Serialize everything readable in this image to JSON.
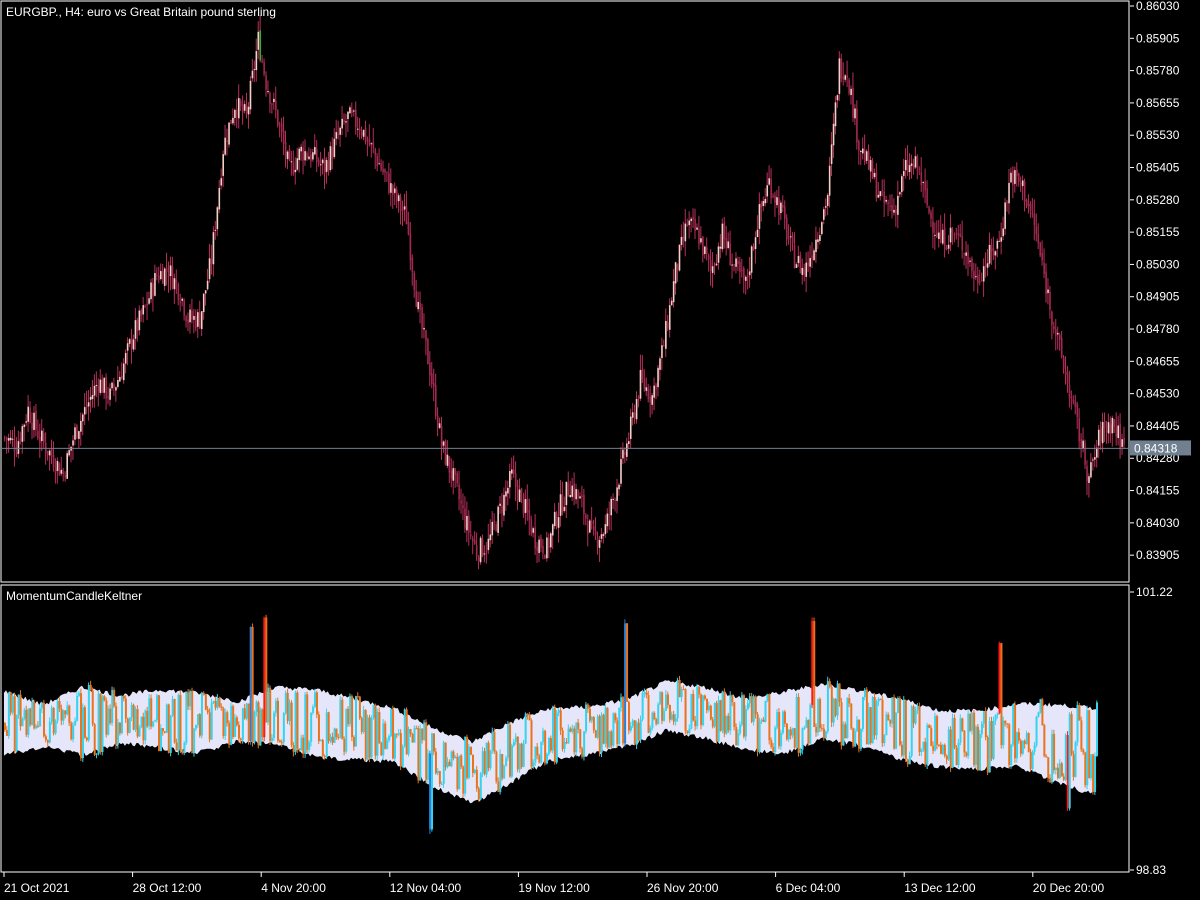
{
  "main_panel": {
    "title": "EURGBP., H4:  euro vs Great Britain pound sterling",
    "current_price": "0.84318"
  },
  "sub_panel": {
    "title": "MomentumCandleKeltner"
  },
  "colors": {
    "background": "#000000",
    "frame": "#ffffff",
    "bull_candle": "#f5cfc3",
    "bear_candle": "#a3294f",
    "wick": "#b8305a",
    "highlight_bull": "#3fa83a",
    "current_price_line": "#708090",
    "price_box": "#708090",
    "band_fill": "#e6e6fa",
    "mom_up": "#35d3ee",
    "mom_down": "#e8731d",
    "mom_strong_down": "#ff1a1a",
    "mom_strong_up": "#2a7fd8"
  },
  "chart_data": [
    {
      "type": "candlestick",
      "title": "EURGBP., H4:  euro vs Great Britain pound sterling",
      "y_ticks": [
        "0.86030",
        "0.85905",
        "0.85780",
        "0.85655",
        "0.85530",
        "0.85405",
        "0.85280",
        "0.85155",
        "0.85030",
        "0.84905",
        "0.84780",
        "0.84655",
        "0.84530",
        "0.84405",
        "0.84280",
        "0.84155",
        "0.84030",
        "0.83905"
      ],
      "ylim": [
        0.83805,
        0.8603
      ],
      "current_price": 0.84318,
      "x_ticks": [
        "21 Oct 2021",
        "28 Oct 12:00",
        "4 Nov 20:00",
        "12 Nov 04:00",
        "19 Nov 12:00",
        "26 Nov 20:00",
        "6 Dec 04:00",
        "13 Dec 12:00",
        "20 Dec 20:00"
      ],
      "close_path": [
        [
          0,
          0.8436
        ],
        [
          6,
          0.8433
        ],
        [
          12,
          0.8447
        ],
        [
          18,
          0.8436
        ],
        [
          24,
          0.8429
        ],
        [
          30,
          0.8422
        ],
        [
          36,
          0.8438
        ],
        [
          42,
          0.8448
        ],
        [
          48,
          0.8458
        ],
        [
          54,
          0.8452
        ],
        [
          60,
          0.8462
        ],
        [
          66,
          0.8476
        ],
        [
          72,
          0.8486
        ],
        [
          78,
          0.8499
        ],
        [
          84,
          0.8501
        ],
        [
          90,
          0.8492
        ],
        [
          94,
          0.8482
        ],
        [
          100,
          0.8482
        ],
        [
          106,
          0.8505
        ],
        [
          112,
          0.8548
        ],
        [
          118,
          0.8565
        ],
        [
          124,
          0.856
        ],
        [
          130,
          0.859
        ],
        [
          134,
          0.8574
        ],
        [
          140,
          0.8559
        ],
        [
          146,
          0.8539
        ],
        [
          152,
          0.8547
        ],
        [
          158,
          0.8545
        ],
        [
          164,
          0.854
        ],
        [
          170,
          0.8551
        ],
        [
          176,
          0.856
        ],
        [
          182,
          0.8557
        ],
        [
          188,
          0.8548
        ],
        [
          194,
          0.8539
        ],
        [
          200,
          0.8529
        ],
        [
          206,
          0.8521
        ],
        [
          212,
          0.8485
        ],
        [
          218,
          0.8463
        ],
        [
          224,
          0.8433
        ],
        [
          230,
          0.842
        ],
        [
          236,
          0.8404
        ],
        [
          242,
          0.8392
        ],
        [
          248,
          0.8395
        ],
        [
          254,
          0.8408
        ],
        [
          260,
          0.8421
        ],
        [
          266,
          0.841
        ],
        [
          272,
          0.8397
        ],
        [
          278,
          0.8393
        ],
        [
          284,
          0.8408
        ],
        [
          290,
          0.8418
        ],
        [
          296,
          0.841
        ],
        [
          302,
          0.8396
        ],
        [
          308,
          0.8401
        ],
        [
          314,
          0.8418
        ],
        [
          320,
          0.8436
        ],
        [
          326,
          0.8458
        ],
        [
          332,
          0.8452
        ],
        [
          338,
          0.8472
        ],
        [
          344,
          0.85
        ],
        [
          350,
          0.8519
        ],
        [
          356,
          0.8514
        ],
        [
          362,
          0.85
        ],
        [
          368,
          0.8515
        ],
        [
          374,
          0.8502
        ],
        [
          380,
          0.8495
        ],
        [
          386,
          0.852
        ],
        [
          392,
          0.8535
        ],
        [
          398,
          0.8524
        ],
        [
          404,
          0.8507
        ],
        [
          410,
          0.85
        ],
        [
          416,
          0.8513
        ],
        [
          422,
          0.853
        ],
        [
          428,
          0.858
        ],
        [
          432,
          0.8578
        ],
        [
          438,
          0.855
        ],
        [
          444,
          0.8539
        ],
        [
          450,
          0.8527
        ],
        [
          456,
          0.8524
        ],
        [
          462,
          0.854
        ],
        [
          468,
          0.8541
        ],
        [
          474,
          0.8523
        ],
        [
          480,
          0.8512
        ],
        [
          486,
          0.8515
        ],
        [
          492,
          0.851
        ],
        [
          498,
          0.8497
        ],
        [
          504,
          0.8505
        ],
        [
          510,
          0.8512
        ],
        [
          516,
          0.8538
        ],
        [
          522,
          0.8533
        ],
        [
          528,
          0.8518
        ],
        [
          534,
          0.8495
        ],
        [
          540,
          0.8473
        ],
        [
          546,
          0.8454
        ],
        [
          552,
          0.8434
        ],
        [
          556,
          0.842
        ],
        [
          562,
          0.8438
        ],
        [
          568,
          0.8442
        ],
        [
          574,
          0.8432
        ]
      ],
      "green_candles": [
        131
      ]
    },
    {
      "type": "momentum_candles_with_keltner_band",
      "title": "MomentumCandleKeltner",
      "y_ticks": [
        "101.22",
        "98.83"
      ],
      "ylim": [
        98.83,
        101.22
      ],
      "band_upper_path": [
        [
          0,
          100.37
        ],
        [
          20,
          100.25
        ],
        [
          40,
          100.4
        ],
        [
          60,
          100.33
        ],
        [
          80,
          100.38
        ],
        [
          100,
          100.35
        ],
        [
          120,
          100.28
        ],
        [
          140,
          100.4
        ],
        [
          160,
          100.38
        ],
        [
          180,
          100.3
        ],
        [
          200,
          100.22
        ],
        [
          220,
          100.05
        ],
        [
          240,
          99.93
        ],
        [
          260,
          100.1
        ],
        [
          280,
          100.22
        ],
        [
          300,
          100.23
        ],
        [
          320,
          100.3
        ],
        [
          340,
          100.45
        ],
        [
          360,
          100.4
        ],
        [
          380,
          100.3
        ],
        [
          400,
          100.36
        ],
        [
          420,
          100.43
        ],
        [
          440,
          100.37
        ],
        [
          460,
          100.3
        ],
        [
          480,
          100.2
        ],
        [
          500,
          100.2
        ],
        [
          520,
          100.26
        ],
        [
          540,
          100.25
        ],
        [
          560,
          100.22
        ]
      ],
      "band_lower_path": [
        [
          0,
          99.82
        ],
        [
          20,
          99.89
        ],
        [
          40,
          99.82
        ],
        [
          60,
          99.92
        ],
        [
          80,
          99.88
        ],
        [
          100,
          99.84
        ],
        [
          120,
          99.94
        ],
        [
          140,
          99.92
        ],
        [
          160,
          99.8
        ],
        [
          180,
          99.78
        ],
        [
          200,
          99.76
        ],
        [
          220,
          99.55
        ],
        [
          240,
          99.4
        ],
        [
          260,
          99.58
        ],
        [
          280,
          99.78
        ],
        [
          300,
          99.82
        ],
        [
          320,
          99.9
        ],
        [
          340,
          100.03
        ],
        [
          360,
          99.96
        ],
        [
          380,
          99.87
        ],
        [
          400,
          99.83
        ],
        [
          420,
          99.96
        ],
        [
          440,
          99.9
        ],
        [
          460,
          99.78
        ],
        [
          480,
          99.72
        ],
        [
          500,
          99.7
        ],
        [
          520,
          99.72
        ],
        [
          540,
          99.58
        ],
        [
          555,
          99.5
        ],
        [
          560,
          99.52
        ]
      ],
      "spikes": [
        {
          "x": 126,
          "value": 100.92,
          "color": "mom_strong_up"
        },
        {
          "x": 133,
          "value": 101.0,
          "color": "mom_strong_down"
        },
        {
          "x": 318,
          "value": 100.95,
          "color": "mom_strong_up"
        },
        {
          "x": 414,
          "value": 100.97,
          "color": "mom_strong_down"
        },
        {
          "x": 218,
          "value": 99.18,
          "color": "mom_strong_up"
        },
        {
          "x": 545,
          "value": 99.36,
          "color": "mom_strong_down"
        },
        {
          "x": 510,
          "value": 100.78,
          "color": "mom_strong_down"
        }
      ]
    }
  ]
}
